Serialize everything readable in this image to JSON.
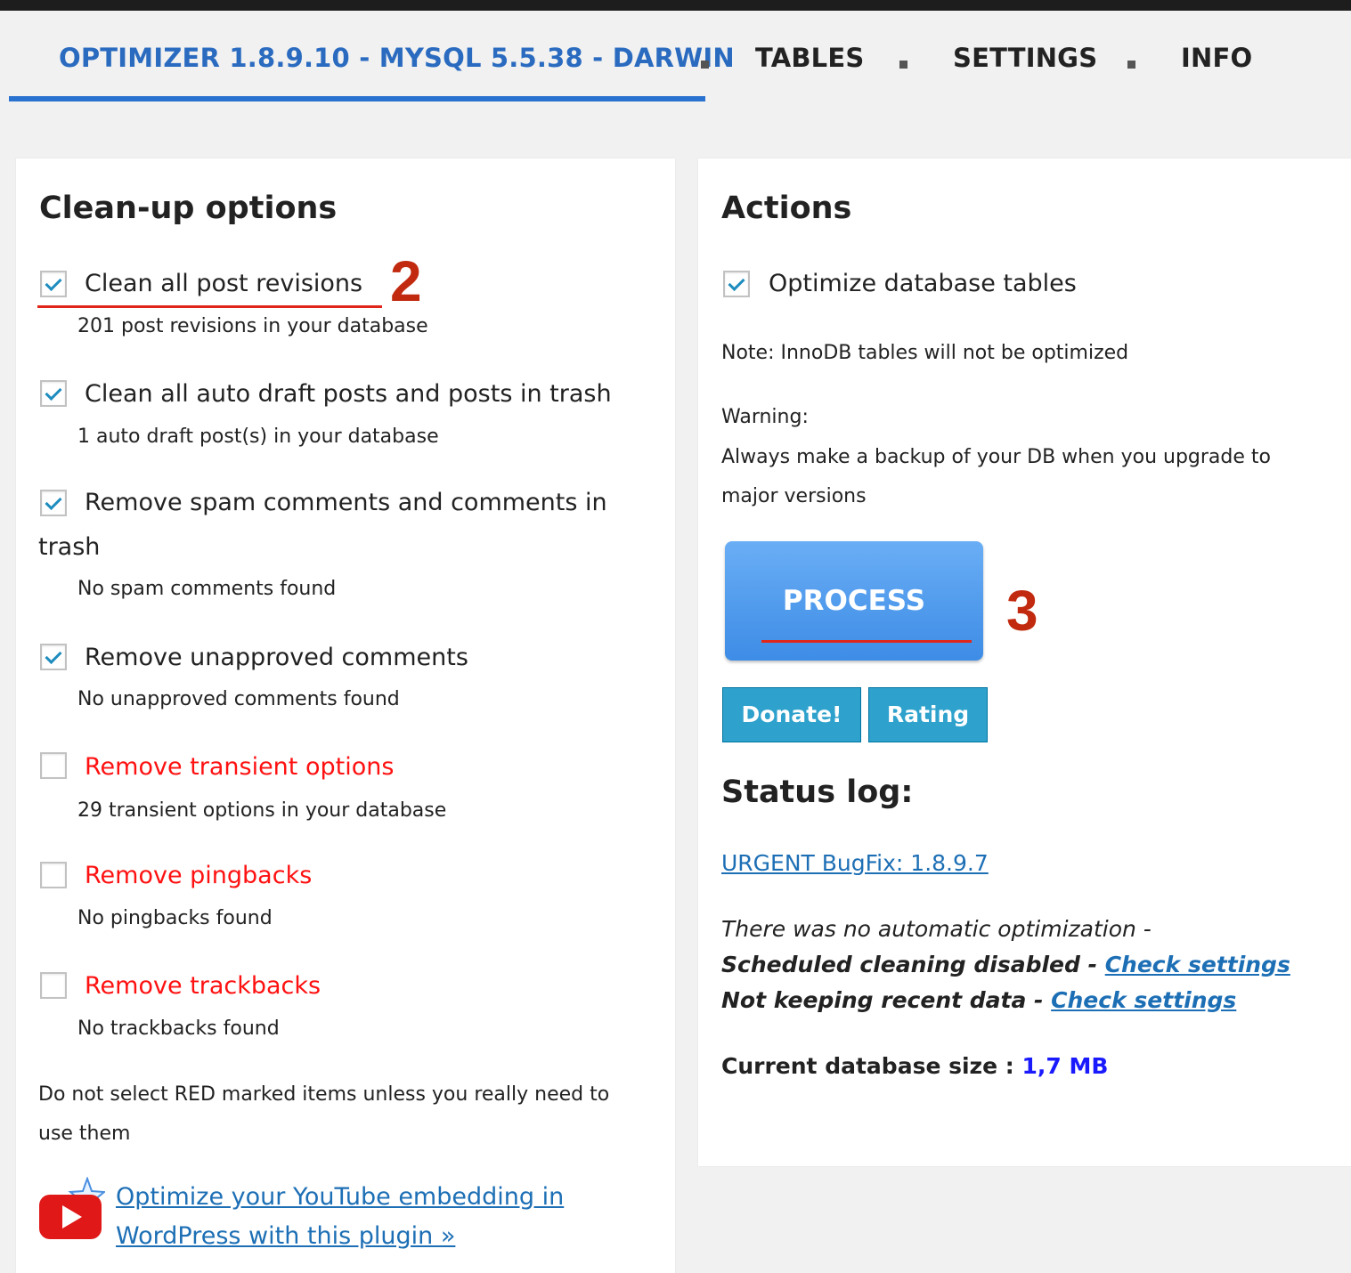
{
  "tabs": [
    {
      "label": "OPTIMIZER 1.8.9.10 - MYSQL 5.5.38 - DARWIN",
      "active": true
    },
    {
      "label": "TABLES",
      "active": false
    },
    {
      "label": "SETTINGS",
      "active": false
    },
    {
      "label": "INFO",
      "active": false
    }
  ],
  "cleanup": {
    "title": "Clean-up options",
    "options": [
      {
        "label": "Clean all post revisions",
        "desc": "201 post revisions in your database",
        "checked": true,
        "red": false
      },
      {
        "label": "Clean all auto draft posts and posts in trash",
        "desc": "1 auto draft post(s) in your database",
        "checked": true,
        "red": false
      },
      {
        "label": "Remove spam comments and comments in trash",
        "desc": "No spam comments found",
        "checked": true,
        "red": false
      },
      {
        "label": "Remove unapproved comments",
        "desc": "No unapproved comments found",
        "checked": true,
        "red": false
      },
      {
        "label": "Remove transient options",
        "desc": "29 transient options in your database",
        "checked": false,
        "red": true
      },
      {
        "label": "Remove pingbacks",
        "desc": "No pingbacks found",
        "checked": false,
        "red": true
      },
      {
        "label": "Remove trackbacks",
        "desc": "No trackbacks found",
        "checked": false,
        "red": true
      }
    ],
    "red_note": "Do not select RED marked items unless you really need to use them",
    "youtube_link": "Optimize your YouTube embedding in WordPress with this plugin »"
  },
  "actions": {
    "title": "Actions",
    "optimize_label": "Optimize database tables",
    "optimize_checked": true,
    "note": "Note:  InnoDB tables will not be optimized",
    "warning_label": "Warning:",
    "warning_text": "Always make a backup of your DB when you upgrade to major versions",
    "process_label": "PROCESS",
    "donate_label": "Donate!",
    "rating_label": "Rating"
  },
  "status": {
    "title": "Status log:",
    "bugfix_link": "URGENT BugFix: 1.8.9.7",
    "line1": "There was no automatic optimization -",
    "line2_prefix": "Scheduled cleaning disabled - ",
    "line3_prefix": "Not keeping recent data - ",
    "check_settings": "Check settings",
    "db_size_label": "Current database size : ",
    "db_size_value": "1,7 MB"
  },
  "annotations": [
    "2",
    "3"
  ],
  "colors": {
    "tab_active": "#2a6bc0",
    "red_option": "#ff1111",
    "annotation": "#c12a0e",
    "process_button": "#3d8ce6",
    "small_button": "#2ea2cc",
    "db_size_value": "#1a1aff"
  }
}
